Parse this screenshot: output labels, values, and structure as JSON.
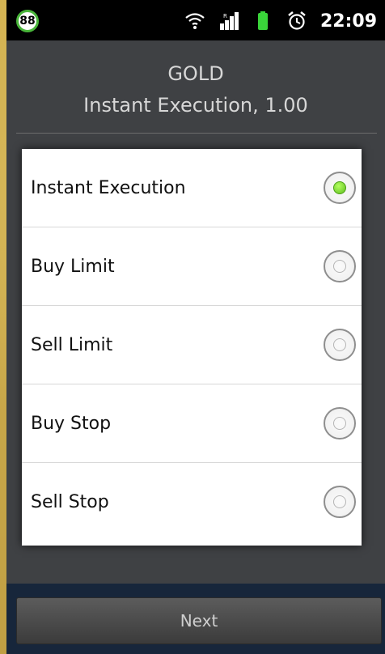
{
  "status_bar": {
    "battery_level": "88",
    "time": "22:09",
    "icons": [
      "wifi-icon",
      "signal-icon",
      "battery-icon",
      "alarm-icon"
    ]
  },
  "order": {
    "symbol": "GOLD",
    "subtitle": "Instant Execution, 1.00"
  },
  "dialog": {
    "options": [
      {
        "label": "Instant Execution",
        "selected": true
      },
      {
        "label": "Buy Limit",
        "selected": false
      },
      {
        "label": "Sell Limit",
        "selected": false
      },
      {
        "label": "Buy Stop",
        "selected": false
      },
      {
        "label": "Sell Stop",
        "selected": false
      }
    ]
  },
  "footer": {
    "next_label": "Next"
  },
  "colors": {
    "accent": "#5ebd1e",
    "frame": "#c9a847"
  }
}
